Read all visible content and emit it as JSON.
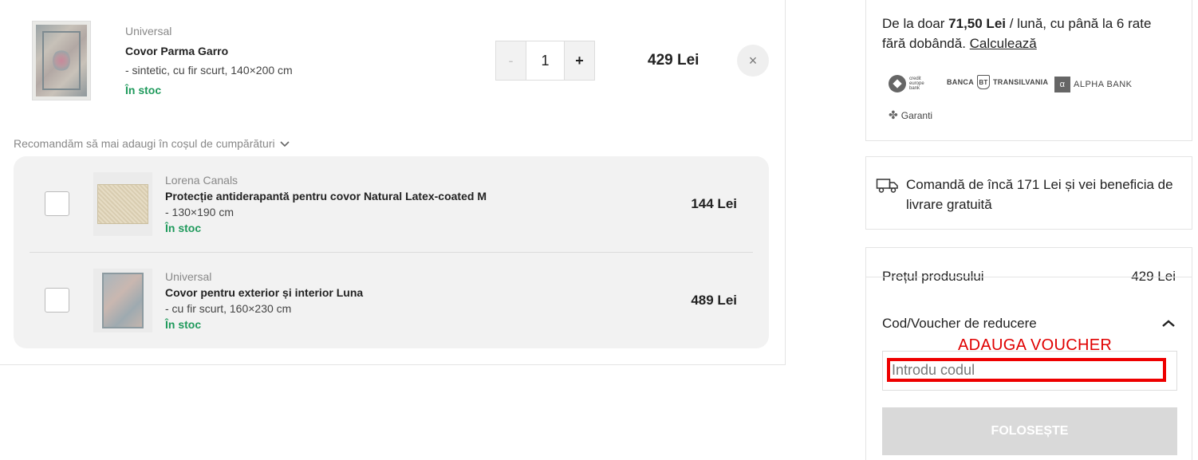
{
  "cart_item": {
    "brand": "Universal",
    "name": "Covor Parma Garro",
    "description": "- sintetic, cu fir scurt, 140×200 cm",
    "stock": "În stoc",
    "quantity": "1",
    "minus_label": "-",
    "plus_label": "+",
    "price": "429 Lei",
    "remove_icon": "×"
  },
  "recommendations": {
    "title": "Recomandăm să mai adaugi în coșul de cumpărături",
    "chevron": "⌄",
    "items": [
      {
        "brand": "Lorena Canals",
        "name": "Protecție antiderapantă pentru covor Natural Latex-coated M",
        "description": "- 130×190 cm",
        "stock": "În stoc",
        "price": "144 Lei"
      },
      {
        "brand": "Universal",
        "name": "Covor pentru exterior și interior Luna",
        "description": "- cu fir scurt, 160×230 cm",
        "stock": "În stoc",
        "price": "489 Lei"
      }
    ]
  },
  "installments": {
    "prefix": "De la doar ",
    "amount": "71,50 Lei",
    "suffix": " / lună, cu până la 6 rate fără dobândă. ",
    "link": "Calculează",
    "banks": {
      "cre_line1": "credit",
      "cre_line2": "europe",
      "cre_line3": "bank",
      "bt_left": "BANCA",
      "bt_mark": "BT",
      "bt_right": "TRANSILVANIA",
      "alpha_mark": "α",
      "alpha": "ALPHA BANK",
      "garanti_mark": "✤",
      "garanti": "Garanti"
    }
  },
  "delivery": {
    "text": "Comandă de încă 171 Lei și vei beneficia de livrare gratuită"
  },
  "summary": {
    "price_label": "Prețul produsului",
    "price_value": "429 Lei",
    "voucher_label": "Cod/Voucher de reducere",
    "chevron": "︿",
    "annotation": "ADAUGA VOUCHER",
    "code_placeholder": "Introdu codul",
    "apply_label": "FOLOSEȘTE"
  },
  "colors": {
    "stock_green": "#1f9a5c",
    "annotation_red": "#e00000"
  }
}
